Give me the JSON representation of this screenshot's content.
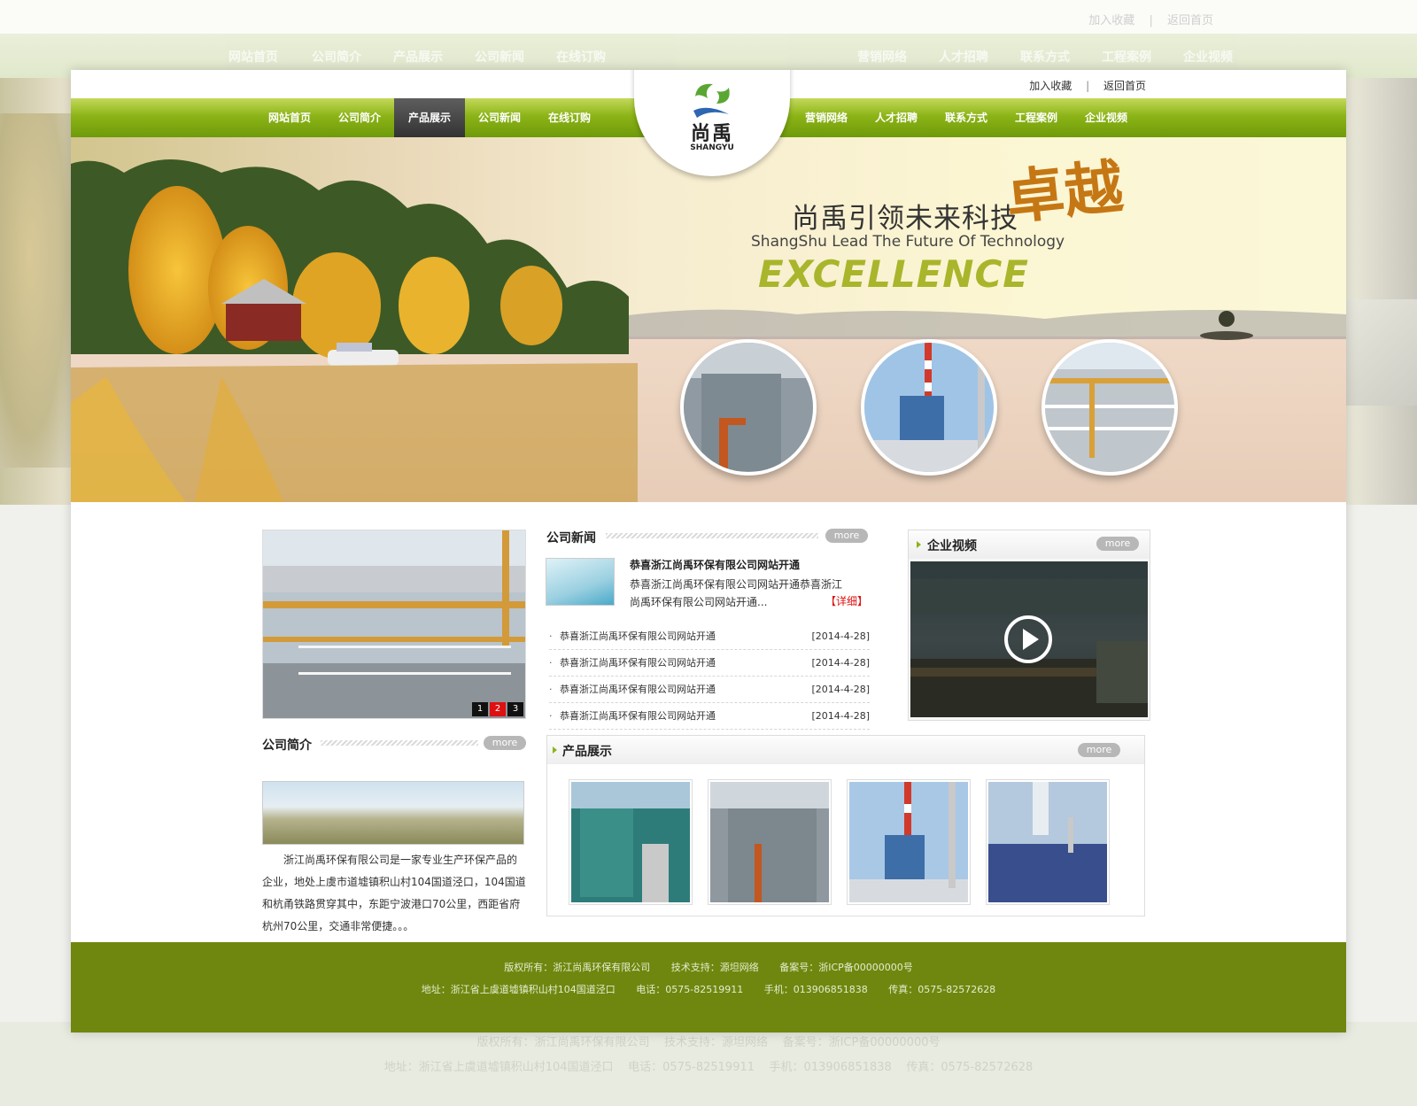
{
  "site": {
    "top_links": [
      "加入收藏",
      "返回首页"
    ],
    "logo_cn": "尚禹",
    "logo_en": "SHANGYU"
  },
  "nav": {
    "left": [
      "网站首页",
      "公司简介",
      "产品展示",
      "公司新闻",
      "在线订购"
    ],
    "right": [
      "营销网络",
      "人才招聘",
      "联系方式",
      "工程案例",
      "企业视频"
    ],
    "active": "产品展示"
  },
  "banner": {
    "slogan_cn": "尚禹引领未来科技",
    "slogan_en": "ShangShu Lead The Future Of Technology",
    "slogan_ex": "EXCELLENCE",
    "slogan_zy": "卓越"
  },
  "slider": {
    "pages": [
      "1",
      "2",
      "3"
    ],
    "active_page": "2"
  },
  "news": {
    "title": "公司新闻",
    "more": "more",
    "featured": {
      "headline": "恭喜浙江尚禹环保有限公司网站开通",
      "desc": "恭喜浙江尚禹环保有限公司网站开通恭喜浙江尚禹环保有限公司网站开通...",
      "detail": "【详细】"
    },
    "items": [
      {
        "title": "恭喜浙江尚禹环保有限公司网站开通",
        "date": "[2014-4-28]"
      },
      {
        "title": "恭喜浙江尚禹环保有限公司网站开通",
        "date": "[2014-4-28]"
      },
      {
        "title": "恭喜浙江尚禹环保有限公司网站开通",
        "date": "[2014-4-28]"
      },
      {
        "title": "恭喜浙江尚禹环保有限公司网站开通",
        "date": "[2014-4-28]"
      }
    ]
  },
  "video": {
    "title": "企业视频",
    "more": "more"
  },
  "intro": {
    "title": "公司简介",
    "more": "more",
    "text": "浙江尚禹环保有限公司是一家专业生产环保产品的企业，地处上虞市道墟镇积山村104国道泾口，104国道和杭甬铁路贯穿其中，东距宁波港口70公里，西距省府杭州70公里，交通非常便捷。。。"
  },
  "products": {
    "title": "产品展示",
    "more": "more"
  },
  "footer": {
    "line1": [
      "版权所有：浙江尚禹环保有限公司",
      "技术支持：源坦网络",
      "备案号：浙ICP备00000000号"
    ],
    "line2": [
      "地址：浙江省上虞道墟镇积山村104国道泾口",
      "电话：0575-82519911",
      "手机：013906851838",
      "传真：0575-82572628"
    ]
  },
  "colors": {
    "nav_green": "#8cb417",
    "footer_green": "#6f870f",
    "active_tab": "#333333",
    "detail_red": "#dd1111"
  }
}
